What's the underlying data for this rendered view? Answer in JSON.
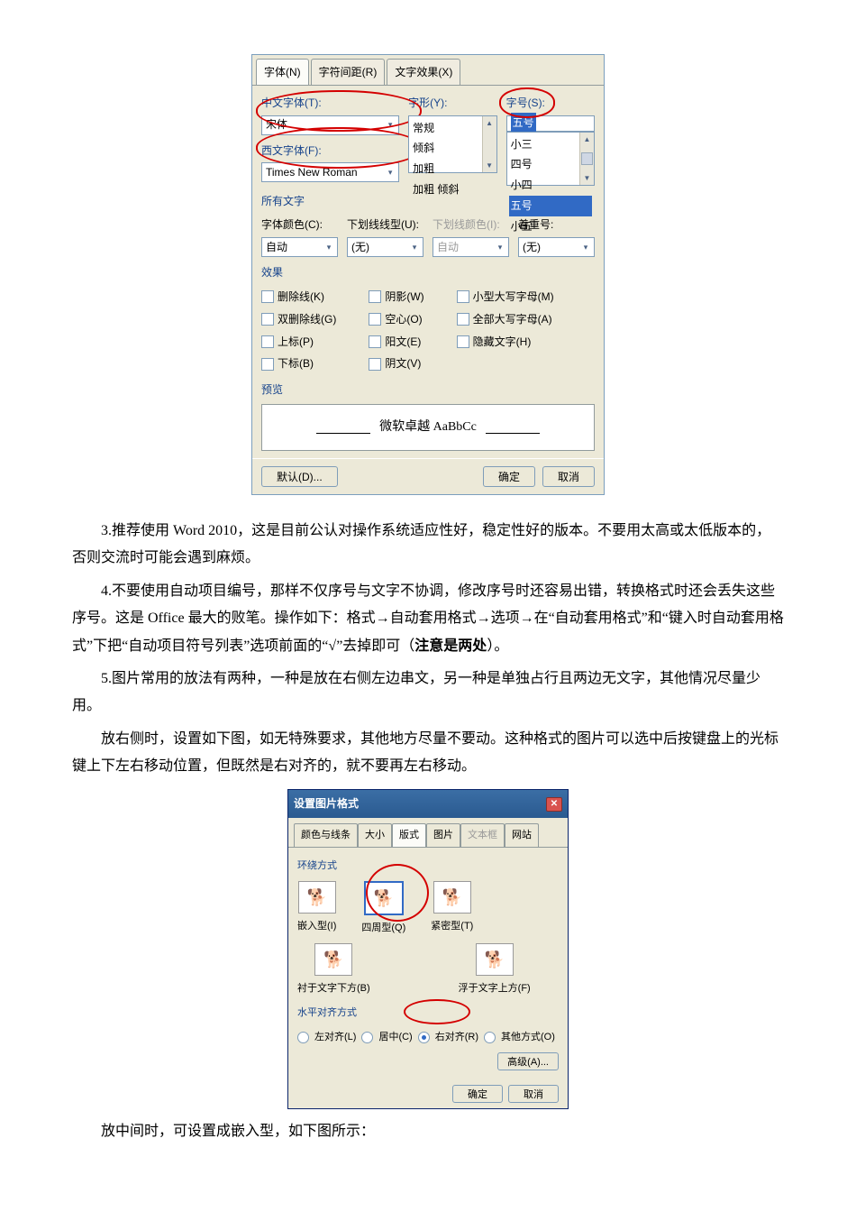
{
  "font_dialog": {
    "tabs": {
      "font": "字体(N)",
      "spacing": "字符间距(R)",
      "effects": "文字效果(X)"
    },
    "labels": {
      "cn_font": "中文字体(T):",
      "en_font": "西文字体(F):",
      "style": "字形(Y):",
      "size": "字号(S):",
      "all_text": "所有文字",
      "font_color": "字体颜色(C):",
      "underline": "下划线线型(U):",
      "underline_color": "下划线颜色(I):",
      "emphasis": "着重号:"
    },
    "values": {
      "cn_font": "宋体",
      "en_font": "Times New Roman",
      "size_selected": "五号",
      "color": "自动",
      "underline": "(无)",
      "underline_color": "自动",
      "emphasis": "(无)"
    },
    "style_list": [
      "常规",
      "倾斜",
      "加粗",
      "加粗 倾斜"
    ],
    "size_list": [
      "小三",
      "四号",
      "小四",
      "五号",
      "小五"
    ],
    "section_effects": "效果",
    "effects": {
      "strike": "删除线(K)",
      "dblstrike": "双删除线(G)",
      "sup": "上标(P)",
      "sub": "下标(B)",
      "shadow": "阴影(W)",
      "outline": "空心(O)",
      "emboss": "阳文(E)",
      "engrave": "阴文(V)",
      "smallcaps": "小型大写字母(M)",
      "allcaps": "全部大写字母(A)",
      "hidden": "隐藏文字(H)"
    },
    "section_preview": "预览",
    "preview_text": "微软卓越 AaBbCc",
    "buttons": {
      "default": "默认(D)...",
      "ok": "确定",
      "cancel": "取消"
    }
  },
  "paragraphs": {
    "p3": "3.推荐使用 Word 2010，这是目前公认对操作系统适应性好，稳定性好的版本。不要用太高或太低版本的，否则交流时可能会遇到麻烦。",
    "p4a": "4.不要使用自动项目编号，那样不仅序号与文字不协调，修改序号时还容易出错，转换格式时还会丢失这些序号。这是 Office 最大的败笔。操作如下：格式→自动套用格式→选项→在“自动套用格式”和“键入时自动套用格式”下把“自动项目符号列表”选项前面的“√”去掉即可（",
    "p4b_bold": "注意是两处",
    "p4c": "）。",
    "p5": "5.图片常用的放法有两种，一种是放在右侧左边串文，另一种是单独占行且两边无文字，其他情况尽量少用。",
    "p6": "放右侧时，设置如下图，如无特殊要求，其他地方尽量不要动。这种格式的图片可以选中后按键盘上的光标键上下左右移动位置，但既然是右对齐的，就不要再左右移动。",
    "p7": "放中间时，可设置成嵌入型，如下图所示："
  },
  "pic_dialog": {
    "title": "设置图片格式",
    "tabs": {
      "color": "颜色与线条",
      "size": "大小",
      "layout": "版式",
      "pic": "图片",
      "textbox": "文本框",
      "web": "网站"
    },
    "wrap_label": "环绕方式",
    "wraps": {
      "inline": "嵌入型(I)",
      "square": "四周型(Q)",
      "tight": "紧密型(T)",
      "behind": "衬于文字下方(B)",
      "front": "浮于文字上方(F)"
    },
    "align_label": "水平对齐方式",
    "aligns": {
      "left": "左对齐(L)",
      "center": "居中(C)",
      "right": "右对齐(R)",
      "other": "其他方式(O)"
    },
    "advanced": "高级(A)...",
    "ok": "确定",
    "cancel": "取消"
  }
}
